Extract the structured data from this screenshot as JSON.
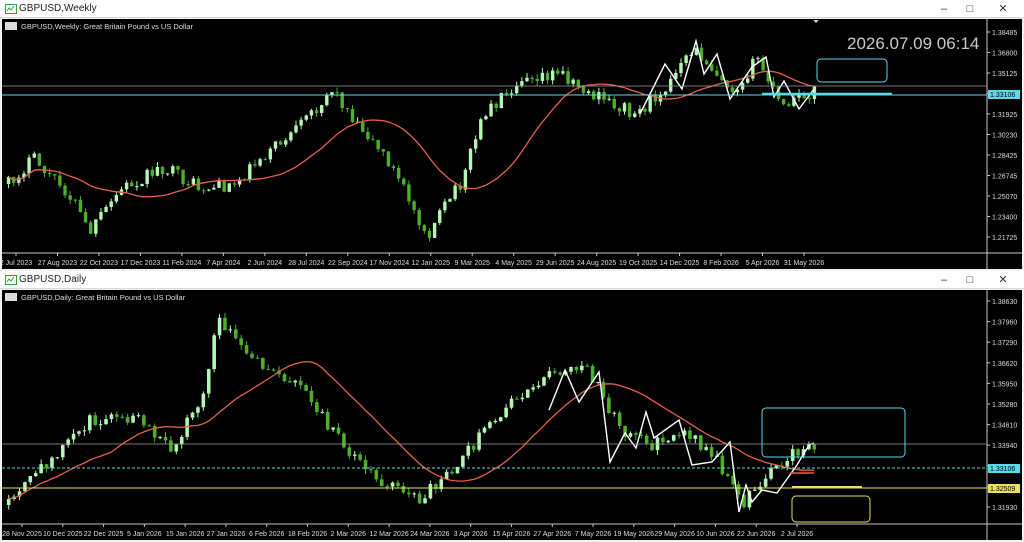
{
  "windows": [
    {
      "id": "weekly",
      "title": "GBPUSD,Weekly",
      "legend": "GBPUSD,Weekly:  Great Britain Pound vs US Dollar",
      "clock": "2026.07.09 06:14",
      "price_labels": [
        "1.38485",
        "1.36800",
        "1.35125",
        "1.33155",
        "1.31925",
        "1.30230",
        "1.28425",
        "1.26745",
        "1.25070",
        "1.23400",
        "1.21725"
      ],
      "bid_label": "1.33106",
      "date_labels": [
        "2 Jul 2023",
        "27 Aug 2023",
        "22 Oct 2023",
        "17 Dec 2023",
        "11 Feb 2024",
        "7 Apr 2024",
        "2 Jun 2024",
        "28 Jul 2024",
        "22 Sep 2024",
        "17 Nov 2024",
        "12 Jan 2025",
        "9 Mar 2025",
        "4 May 2025",
        "29 Jun 2025",
        "24 Aug 2025",
        "19 Oct 2025",
        "14 Dec 2025",
        "8 Feb 2026",
        "5 Apr 2026",
        "31 May 2026"
      ],
      "colors": {
        "bull": "#b4f7b4",
        "bear": "#4caf2e",
        "ma": "#e4604e",
        "hline": "#5fd8e8",
        "zigzag": "#ffffff"
      }
    },
    {
      "id": "daily",
      "title": "GBPUSD,Daily",
      "legend": "GBPUSD,Daily:  Great Britain Pound vs US Dollar",
      "price_labels": [
        "1.38630",
        "1.37960",
        "1.37290",
        "1.36620",
        "1.35950",
        "1.35280",
        "1.34610",
        "1.33940",
        "1.33270",
        "1.32599",
        "1.31930"
      ],
      "bid_label": "1.33106",
      "yellow_label": "1.32509",
      "date_labels": [
        "28 Nov 2025",
        "10 Dec 2025",
        "22 Dec 2025",
        "5 Jan 2026",
        "15 Jan 2026",
        "27 Jan 2026",
        "6 Feb 2026",
        "18 Feb 2026",
        "2 Mar 2026",
        "12 Mar 2026",
        "24 Mar 2026",
        "3 Apr 2026",
        "15 Apr 2026",
        "27 Apr 2026",
        "7 May 2026",
        "19 May 2026",
        "29 May 2026",
        "10 Jun 2026",
        "22 Jun 2026",
        "2 Jul 2026"
      ],
      "colors": {
        "bull": "#b4f7b4",
        "bear": "#4caf2e",
        "ma": "#e4604e",
        "hline": "#5fd8e8",
        "yline": "#e8e060",
        "zigzag": "#ffffff"
      }
    }
  ]
}
